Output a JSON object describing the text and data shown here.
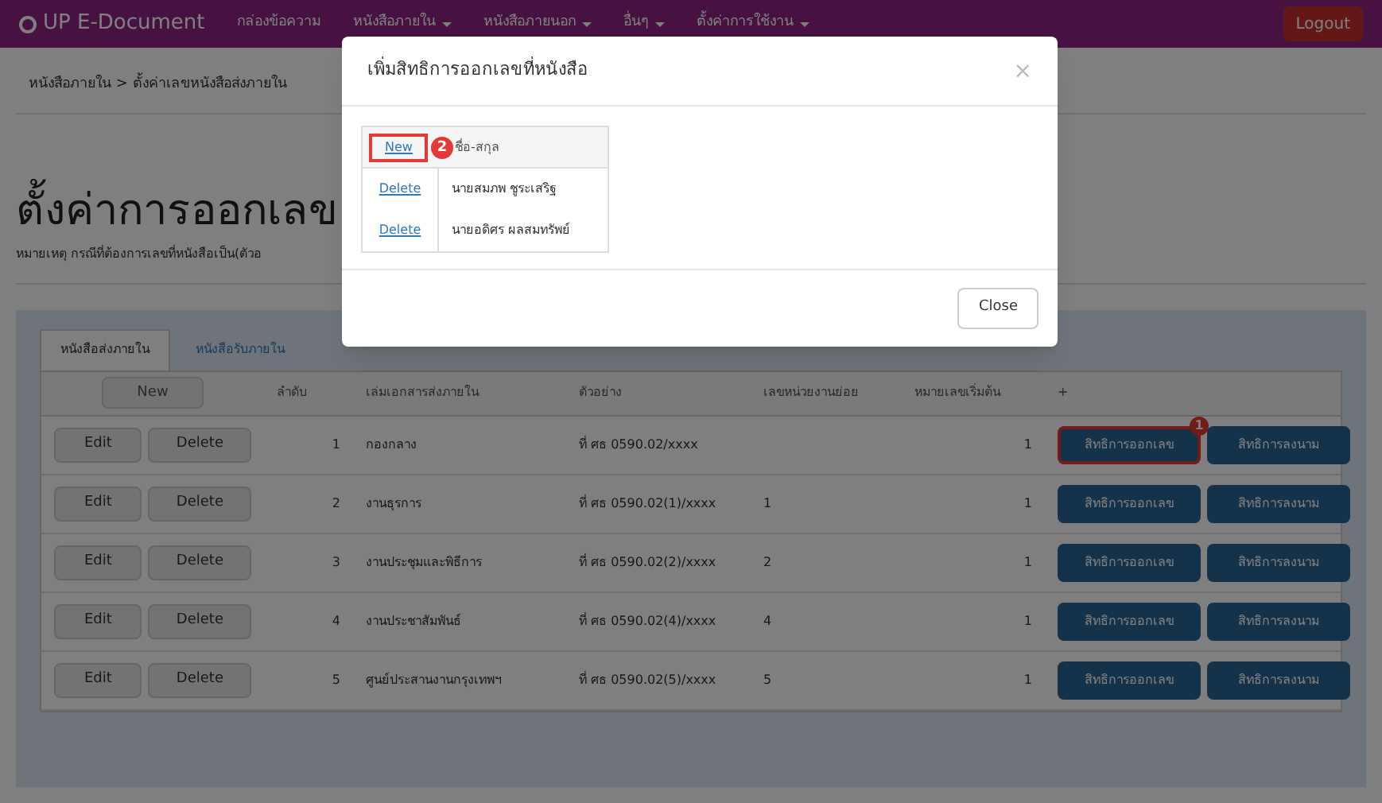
{
  "navbar": {
    "brand": "UP E-Document",
    "items": [
      {
        "label": "กล่องข้อความ",
        "dropdown": false
      },
      {
        "label": "หนังสือภายใน",
        "dropdown": true
      },
      {
        "label": "หนังสือภายนอก",
        "dropdown": true
      },
      {
        "label": "อื่นๆ",
        "dropdown": true
      },
      {
        "label": "ตั้งค่าการใช้งาน",
        "dropdown": true
      }
    ],
    "logout": "Logout"
  },
  "breadcrumb": "หนังสือภายใน > ตั้งค่าเลขหนังสือส่งภายใน",
  "page_title": "ตั้งค่าการออกเลข",
  "note": "หมายเหตุ กรณีที่ต้องการเลขที่หนังสือเป็น(ตัวอ",
  "tabs": [
    {
      "label": "หนังสือส่งภายใน",
      "selected": true
    },
    {
      "label": "หนังสือรับภายใน",
      "selected": false
    }
  ],
  "table": {
    "new_button": "New",
    "columns": [
      "ลำดับ",
      "เล่มเอกสารส่งภายใน",
      "ตัวอย่าง",
      "เลขหน่วยงานย่อย",
      "หมายเลขเริ่มต้น",
      "+"
    ],
    "rows": [
      {
        "edit": "Edit",
        "delete": "Delete",
        "no": "1",
        "name": "กองกลาง",
        "example": "ที่ ศธ 0590.02/xxxx",
        "sub": "",
        "start": "1",
        "actions": [
          {
            "label": "สิทธิการออกเลข",
            "highlighted": true,
            "badge": "1"
          },
          {
            "label": "สิทธิการลงนาม",
            "highlighted": false
          }
        ]
      },
      {
        "edit": "Edit",
        "delete": "Delete",
        "no": "2",
        "name": "งานธุรการ",
        "example": "ที่ ศธ 0590.02(1)/xxxx",
        "sub": "1",
        "start": "1",
        "actions": [
          {
            "label": "สิทธิการออกเลข",
            "highlighted": false
          },
          {
            "label": "สิทธิการลงนาม",
            "highlighted": false
          }
        ]
      },
      {
        "edit": "Edit",
        "delete": "Delete",
        "no": "3",
        "name": "งานประชุมและพิธีการ",
        "example": "ที่ ศธ 0590.02(2)/xxxx",
        "sub": "2",
        "start": "1",
        "actions": [
          {
            "label": "สิทธิการออกเลข",
            "highlighted": false
          },
          {
            "label": "สิทธิการลงนาม",
            "highlighted": false
          }
        ]
      },
      {
        "edit": "Edit",
        "delete": "Delete",
        "no": "4",
        "name": "งานประชาสัมพันธ์",
        "example": "ที่ ศธ 0590.02(4)/xxxx",
        "sub": "4",
        "start": "1",
        "actions": [
          {
            "label": "สิทธิการออกเลข",
            "highlighted": false
          },
          {
            "label": "สิทธิการลงนาม",
            "highlighted": false
          }
        ]
      },
      {
        "edit": "Edit",
        "delete": "Delete",
        "no": "5",
        "name": "ศูนย์ประสานงานกรุงเทพฯ",
        "example": "ที่ ศธ 0590.02(5)/xxxx",
        "sub": "5",
        "start": "1",
        "actions": [
          {
            "label": "สิทธิการออกเลข",
            "highlighted": false
          },
          {
            "label": "สิทธิการลงนาม",
            "highlighted": false
          }
        ]
      }
    ]
  },
  "modal": {
    "title": "เพิ่มสิทธิการออกเลขที่หนังสือ",
    "close_icon": "×",
    "new_link": {
      "label": "New",
      "highlighted": true,
      "badge": "2"
    },
    "name_header": "ชื่อ-สกุล",
    "rows": [
      {
        "action": "Delete",
        "name": "นายสมภพ ชูระเสริฐ"
      },
      {
        "action": "Delete",
        "name": "นายอดิศร ผลสมทรัพย์"
      }
    ],
    "close_button": "Close"
  }
}
